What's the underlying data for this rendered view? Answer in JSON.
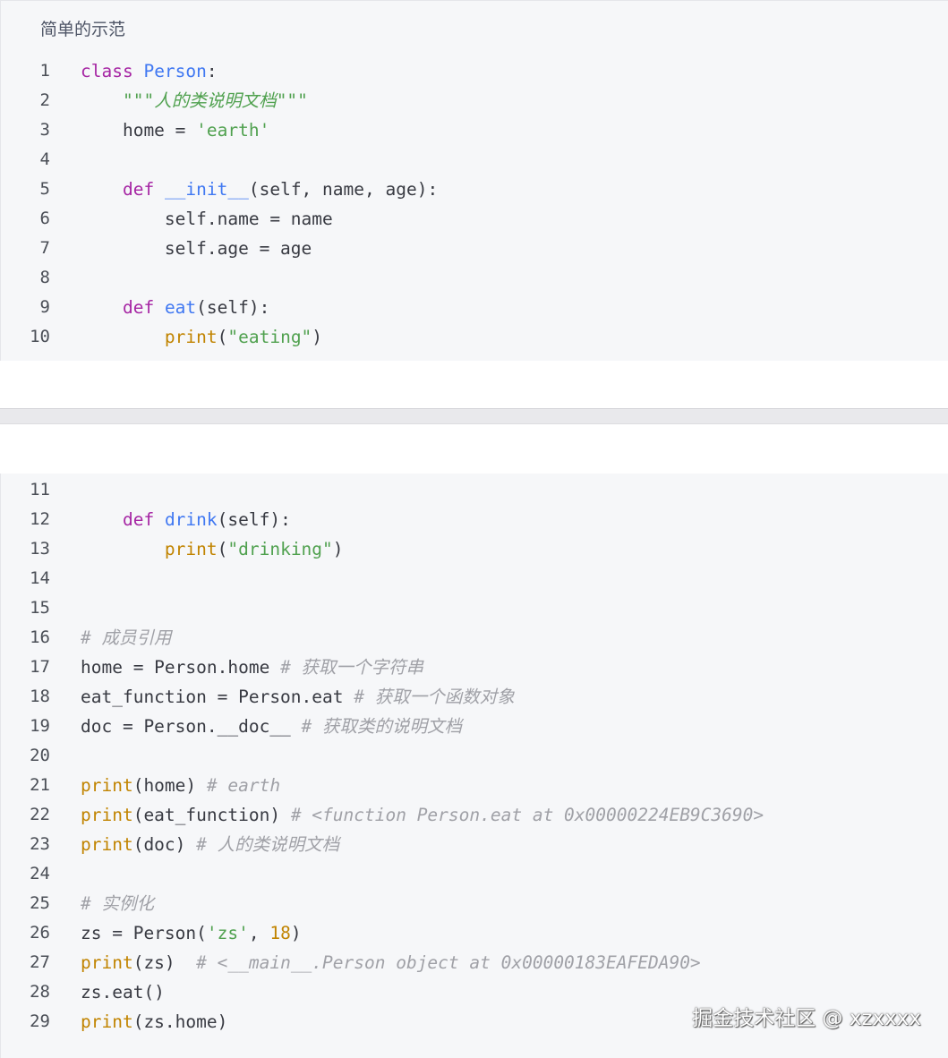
{
  "title": "简单的示范",
  "watermark": "掘金技术社区 @ xzxxxx",
  "theme": {
    "keyword": "#a626a4",
    "function": "#4078f2",
    "string": "#50a14f",
    "builtin": "#c18401",
    "number": "#c18401",
    "comment": "#a0a1a7",
    "text": "#383a42",
    "line_number": "#4b4f57",
    "background": "#f6f7f9"
  },
  "blocks": [
    {
      "lines": [
        {
          "n": "1",
          "tokens": [
            {
              "t": "class ",
              "k": "kw"
            },
            {
              "t": "Person",
              "k": "fn"
            },
            {
              "t": ":",
              "k": "plain"
            }
          ]
        },
        {
          "n": "2",
          "tokens": [
            {
              "t": "    ",
              "k": "plain"
            },
            {
              "t": "\"\"\"人的类说明文档\"\"\"",
              "k": "doc"
            }
          ]
        },
        {
          "n": "3",
          "tokens": [
            {
              "t": "    home = ",
              "k": "plain"
            },
            {
              "t": "'earth'",
              "k": "str"
            }
          ]
        },
        {
          "n": "4",
          "tokens": []
        },
        {
          "n": "5",
          "tokens": [
            {
              "t": "    ",
              "k": "plain"
            },
            {
              "t": "def ",
              "k": "kw"
            },
            {
              "t": "__init__",
              "k": "fn"
            },
            {
              "t": "(self, name, age):",
              "k": "plain"
            }
          ]
        },
        {
          "n": "6",
          "tokens": [
            {
              "t": "        self.name = name",
              "k": "plain"
            }
          ]
        },
        {
          "n": "7",
          "tokens": [
            {
              "t": "        self.age = age",
              "k": "plain"
            }
          ]
        },
        {
          "n": "8",
          "tokens": []
        },
        {
          "n": "9",
          "tokens": [
            {
              "t": "    ",
              "k": "plain"
            },
            {
              "t": "def ",
              "k": "kw"
            },
            {
              "t": "eat",
              "k": "fn"
            },
            {
              "t": "(self):",
              "k": "plain"
            }
          ]
        },
        {
          "n": "10",
          "tokens": [
            {
              "t": "        ",
              "k": "plain"
            },
            {
              "t": "print",
              "k": "bi"
            },
            {
              "t": "(",
              "k": "plain"
            },
            {
              "t": "\"eating\"",
              "k": "str"
            },
            {
              "t": ")",
              "k": "plain"
            }
          ]
        }
      ]
    },
    {
      "lines": [
        {
          "n": "11",
          "tokens": []
        },
        {
          "n": "12",
          "tokens": [
            {
              "t": "    ",
              "k": "plain"
            },
            {
              "t": "def ",
              "k": "kw"
            },
            {
              "t": "drink",
              "k": "fn"
            },
            {
              "t": "(self):",
              "k": "plain"
            }
          ]
        },
        {
          "n": "13",
          "tokens": [
            {
              "t": "        ",
              "k": "plain"
            },
            {
              "t": "print",
              "k": "bi"
            },
            {
              "t": "(",
              "k": "plain"
            },
            {
              "t": "\"drinking\"",
              "k": "str"
            },
            {
              "t": ")",
              "k": "plain"
            }
          ]
        },
        {
          "n": "14",
          "tokens": []
        },
        {
          "n": "15",
          "tokens": []
        },
        {
          "n": "16",
          "tokens": [
            {
              "t": "# 成员引用",
              "k": "com"
            }
          ]
        },
        {
          "n": "17",
          "tokens": [
            {
              "t": "home = Person.home ",
              "k": "plain"
            },
            {
              "t": "# 获取一个字符串",
              "k": "com"
            }
          ]
        },
        {
          "n": "18",
          "tokens": [
            {
              "t": "eat_function = Person.eat ",
              "k": "plain"
            },
            {
              "t": "# 获取一个函数对象",
              "k": "com"
            }
          ]
        },
        {
          "n": "19",
          "tokens": [
            {
              "t": "doc = Person.__doc__ ",
              "k": "plain"
            },
            {
              "t": "# 获取类的说明文档",
              "k": "com"
            }
          ]
        },
        {
          "n": "20",
          "tokens": []
        },
        {
          "n": "21",
          "tokens": [
            {
              "t": "print",
              "k": "bi"
            },
            {
              "t": "(home) ",
              "k": "plain"
            },
            {
              "t": "# earth",
              "k": "com"
            }
          ]
        },
        {
          "n": "22",
          "tokens": [
            {
              "t": "print",
              "k": "bi"
            },
            {
              "t": "(eat_function) ",
              "k": "plain"
            },
            {
              "t": "# <function Person.eat at 0x00000224EB9C3690>",
              "k": "com"
            }
          ]
        },
        {
          "n": "23",
          "tokens": [
            {
              "t": "print",
              "k": "bi"
            },
            {
              "t": "(doc) ",
              "k": "plain"
            },
            {
              "t": "# 人的类说明文档",
              "k": "com"
            }
          ]
        },
        {
          "n": "24",
          "tokens": []
        },
        {
          "n": "25",
          "tokens": [
            {
              "t": "# 实例化",
              "k": "com"
            }
          ]
        },
        {
          "n": "26",
          "tokens": [
            {
              "t": "zs = Person(",
              "k": "plain"
            },
            {
              "t": "'zs'",
              "k": "str"
            },
            {
              "t": ", ",
              "k": "plain"
            },
            {
              "t": "18",
              "k": "num"
            },
            {
              "t": ")",
              "k": "plain"
            }
          ]
        },
        {
          "n": "27",
          "tokens": [
            {
              "t": "print",
              "k": "bi"
            },
            {
              "t": "(zs)  ",
              "k": "plain"
            },
            {
              "t": "# <__main__.Person object at 0x00000183EAFEDA90>",
              "k": "com"
            }
          ]
        },
        {
          "n": "28",
          "tokens": [
            {
              "t": "zs.eat()",
              "k": "plain"
            }
          ]
        },
        {
          "n": "29",
          "tokens": [
            {
              "t": "print",
              "k": "bi"
            },
            {
              "t": "(zs.home)",
              "k": "plain"
            }
          ]
        }
      ]
    }
  ]
}
